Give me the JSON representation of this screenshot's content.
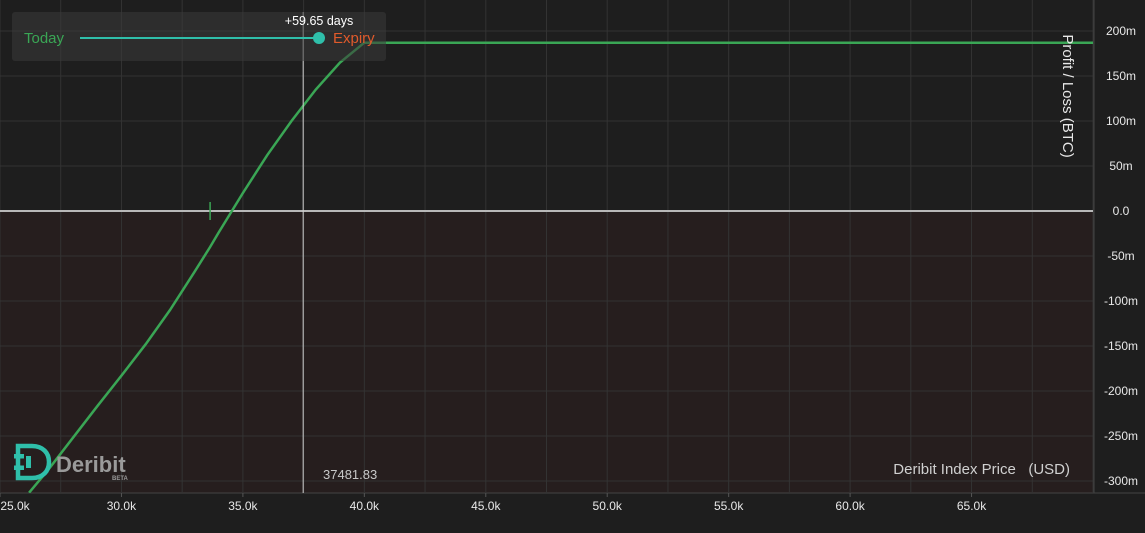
{
  "chart_data": {
    "type": "line",
    "title": "",
    "xlabel": "Deribit Index Price   (USD)",
    "ylabel": "Profit / Loss   (BTC)",
    "xlim": [
      25000,
      70000
    ],
    "ylim": [
      -300,
      200
    ],
    "x_ticks": [
      25000,
      30000,
      35000,
      40000,
      45000,
      50000,
      55000,
      60000,
      65000
    ],
    "x_tick_labels": [
      "25.0k",
      "30.0k",
      "35.0k",
      "40.0k",
      "45.0k",
      "50.0k",
      "55.0k",
      "60.0k",
      "65.0k"
    ],
    "y_ticks": [
      200,
      150,
      100,
      50,
      0,
      -50,
      -100,
      -150,
      -200,
      -250,
      -300
    ],
    "y_tick_labels": [
      "200m",
      "150m",
      "100m",
      "50m",
      "0.0",
      "-50m",
      "-100m",
      "-150m",
      "-200m",
      "-250m",
      "-300m"
    ],
    "y_unit_note": "values in mBTC",
    "grid": true,
    "legend_placement": "top-left",
    "series": [
      {
        "name": "Today",
        "color": "#2fbfaa",
        "x": [],
        "y": []
      },
      {
        "name": "Expiry",
        "color": "#3aa655",
        "x": [
          26200,
          27000,
          28000,
          29000,
          30000,
          31000,
          32000,
          33000,
          33650,
          34000,
          35000,
          36000,
          37000,
          38000,
          39000,
          40000,
          41000,
          50000,
          60000,
          70000
        ],
        "y": [
          -313,
          -287,
          -252,
          -217,
          -183,
          -148,
          -110,
          -68,
          -40,
          -24,
          20,
          62,
          100,
          135,
          165,
          187,
          187,
          187,
          187,
          187
        ]
      }
    ],
    "annotations": {
      "days_label": "+59.65 days",
      "crosshair_x": 37481.83,
      "crosshair_label": "37481.83",
      "break_even_x": 33650
    }
  },
  "legend": {
    "today_label": "Today",
    "expiry_label": "Expiry",
    "days_label": "+59.65 days"
  },
  "branding": {
    "name": "Deribit",
    "tag": "BETA",
    "logo_icon": "deribit-d-logo-icon"
  },
  "colors": {
    "background": "#1e1e1e",
    "loss_background": "#261e1e",
    "grid": "#333333",
    "zero_line": "#b8b8b8",
    "expiry_line": "#3aa655",
    "today_line": "#2fbfaa",
    "expiry_label": "#e05a2b",
    "axis_text": "#e8e8e8",
    "logo": "#2fbfaa"
  }
}
